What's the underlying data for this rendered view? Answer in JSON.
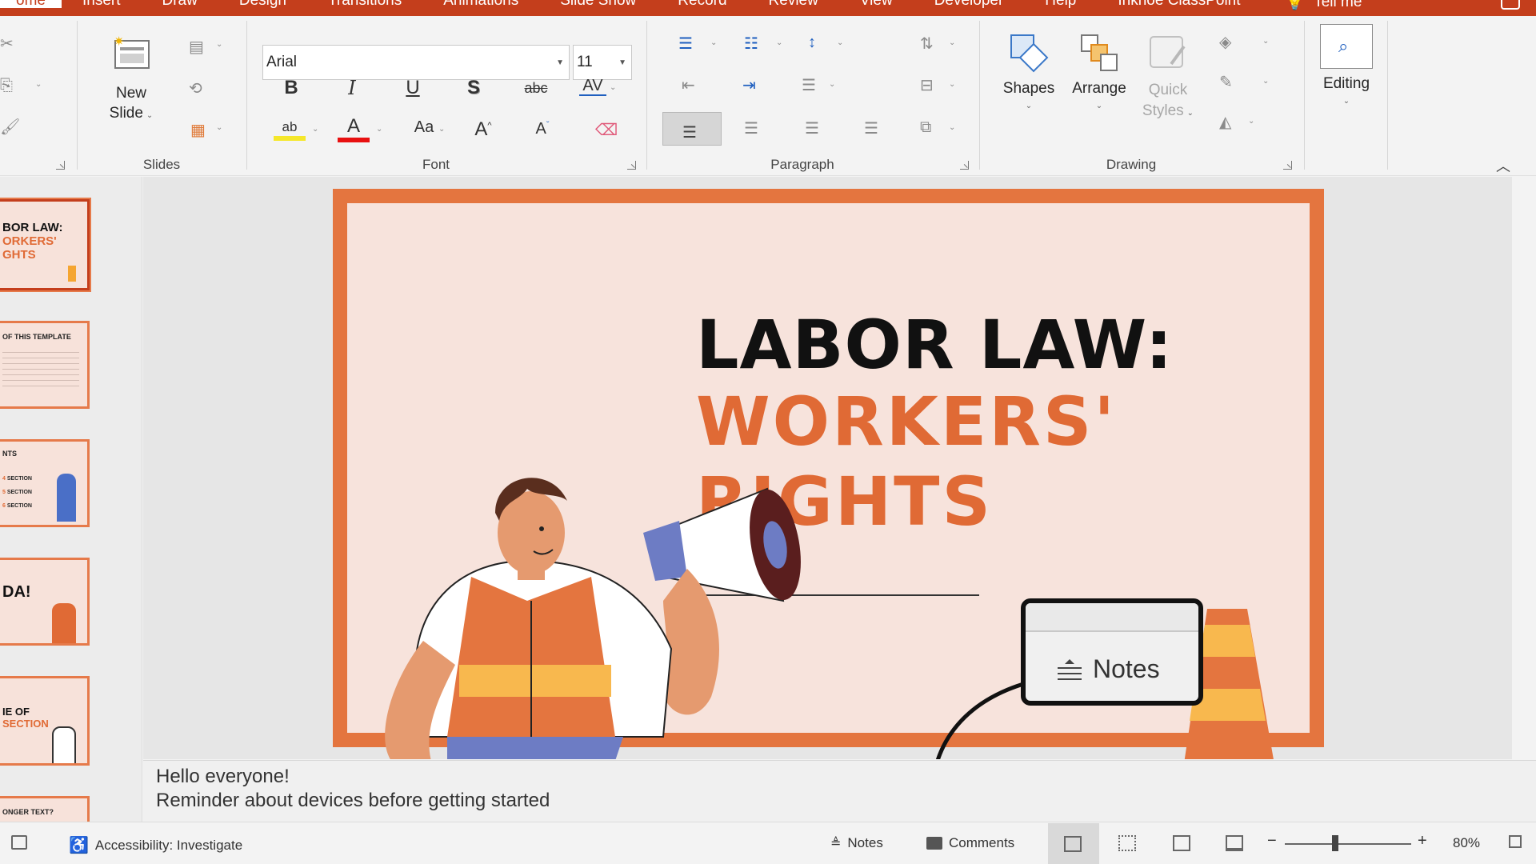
{
  "tabs": [
    {
      "label": "ome",
      "active": true
    },
    {
      "label": "Insert"
    },
    {
      "label": "Draw"
    },
    {
      "label": "Design"
    },
    {
      "label": "Transitions"
    },
    {
      "label": "Animations"
    },
    {
      "label": "Slide Show"
    },
    {
      "label": "Record"
    },
    {
      "label": "Review"
    },
    {
      "label": "View"
    },
    {
      "label": "Developer"
    },
    {
      "label": "Help"
    },
    {
      "label": "Inknoe ClassPoint"
    }
  ],
  "tell_me": "Tell me",
  "ribbon": {
    "slides": {
      "new_slide_line1": "New",
      "new_slide_line2": "Slide",
      "label": "Slides"
    },
    "font": {
      "name": "Arial",
      "size": "11",
      "bold": "B",
      "italic": "I",
      "underline": "U",
      "shadow": "S",
      "strike": "abc",
      "spacing": "AV",
      "highlight": "ab",
      "color": "A",
      "case": "Aa",
      "grow": "A",
      "shrink": "A",
      "label": "Font"
    },
    "paragraph": {
      "label": "Paragraph"
    },
    "drawing": {
      "shapes": "Shapes",
      "arrange": "Arrange",
      "quick_styles_line1": "Quick",
      "quick_styles_line2": "Styles",
      "label": "Drawing"
    },
    "editing": {
      "label": "Editing"
    }
  },
  "thumbnails": [
    {
      "line1": "BOR LAW:",
      "line2": "ORKERS'",
      "line3": "GHTS",
      "selected": true
    },
    {
      "line1": "OF THIS TEMPLATE"
    },
    {
      "line1": "NTS",
      "items": [
        "SECTION",
        "SECTION",
        "SECTION"
      ]
    },
    {
      "line1": "DA!"
    },
    {
      "line1": "IE OF",
      "line2": "SECTION"
    },
    {
      "line1": "ONGER TEXT?"
    }
  ],
  "slide": {
    "title_line1": "LABOR LAW:",
    "title_line2": "WORKERS'",
    "title_line3": "RIGHTS",
    "callout_label": "Notes",
    "colors": {
      "frame": "#e4753f",
      "background": "#f7e3dc",
      "accent": "#e06a35"
    }
  },
  "notes": {
    "line1": "Hello everyone!",
    "line2": "Reminder about devices before getting started"
  },
  "statusbar": {
    "accessibility": "Accessibility: Investigate",
    "notes": "Notes",
    "comments": "Comments",
    "zoom_percent": "80%",
    "zoom_minus": "−",
    "zoom_plus": "+"
  }
}
